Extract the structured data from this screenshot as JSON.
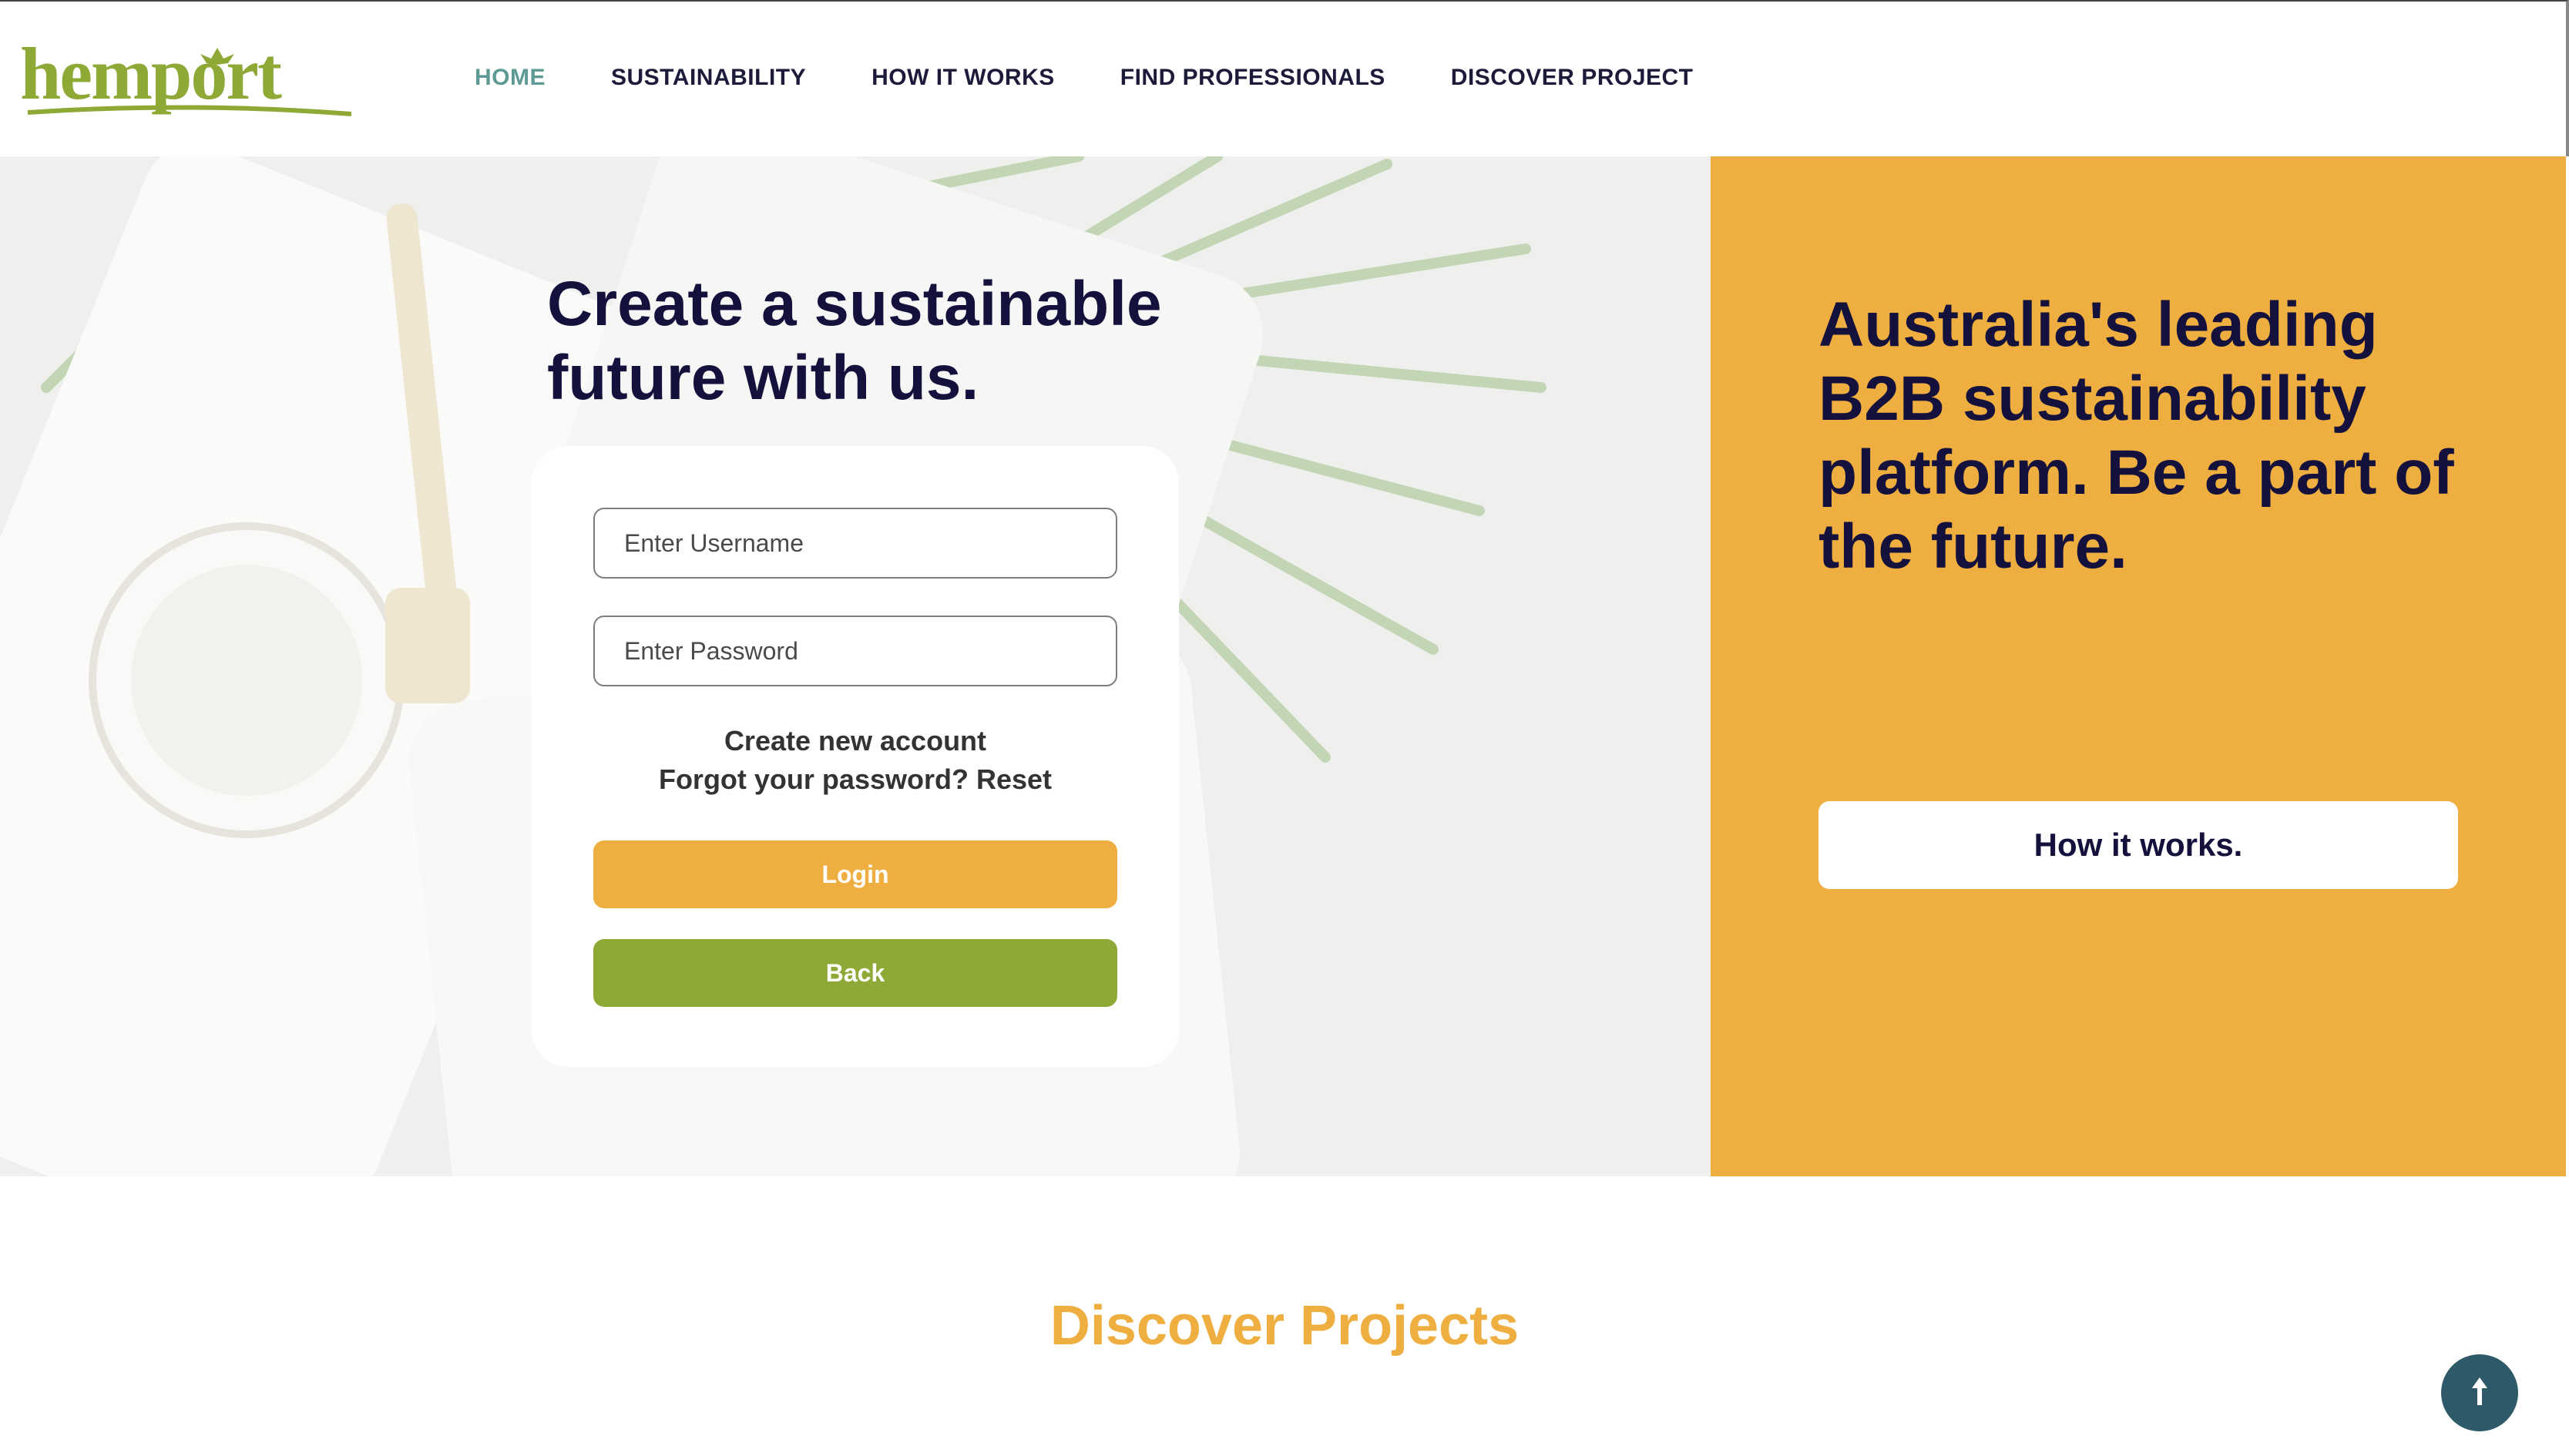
{
  "logo": {
    "text": "hemport",
    "color": "#8fa937"
  },
  "nav": {
    "items": [
      {
        "label": "HOME",
        "active": true
      },
      {
        "label": "SUSTAINABILITY",
        "active": false
      },
      {
        "label": "HOW IT WORKS",
        "active": false
      },
      {
        "label": "FIND PROFESSIONALS",
        "active": false
      },
      {
        "label": "DISCOVER PROJECT",
        "active": false
      }
    ]
  },
  "hero": {
    "title_line1": "Create a sustainable",
    "title_line2": "future with us."
  },
  "login": {
    "username_placeholder": "Enter Username",
    "password_placeholder": "Enter Password",
    "create_account": "Create new account",
    "forgot_password": "Forgot your password? Reset",
    "login_label": "Login",
    "back_label": "Back"
  },
  "panel": {
    "text": "Australia's leading B2B sustainability platform. Be a part of the future.",
    "button_label": "How it works."
  },
  "section": {
    "title": "Discover Projects"
  },
  "scroll_top": {
    "icon": "arrow-up-icon"
  },
  "colors": {
    "accent_orange": "#efae40",
    "accent_green": "#8fa937",
    "navy": "#14113d",
    "nav_active": "#5e9a94"
  }
}
